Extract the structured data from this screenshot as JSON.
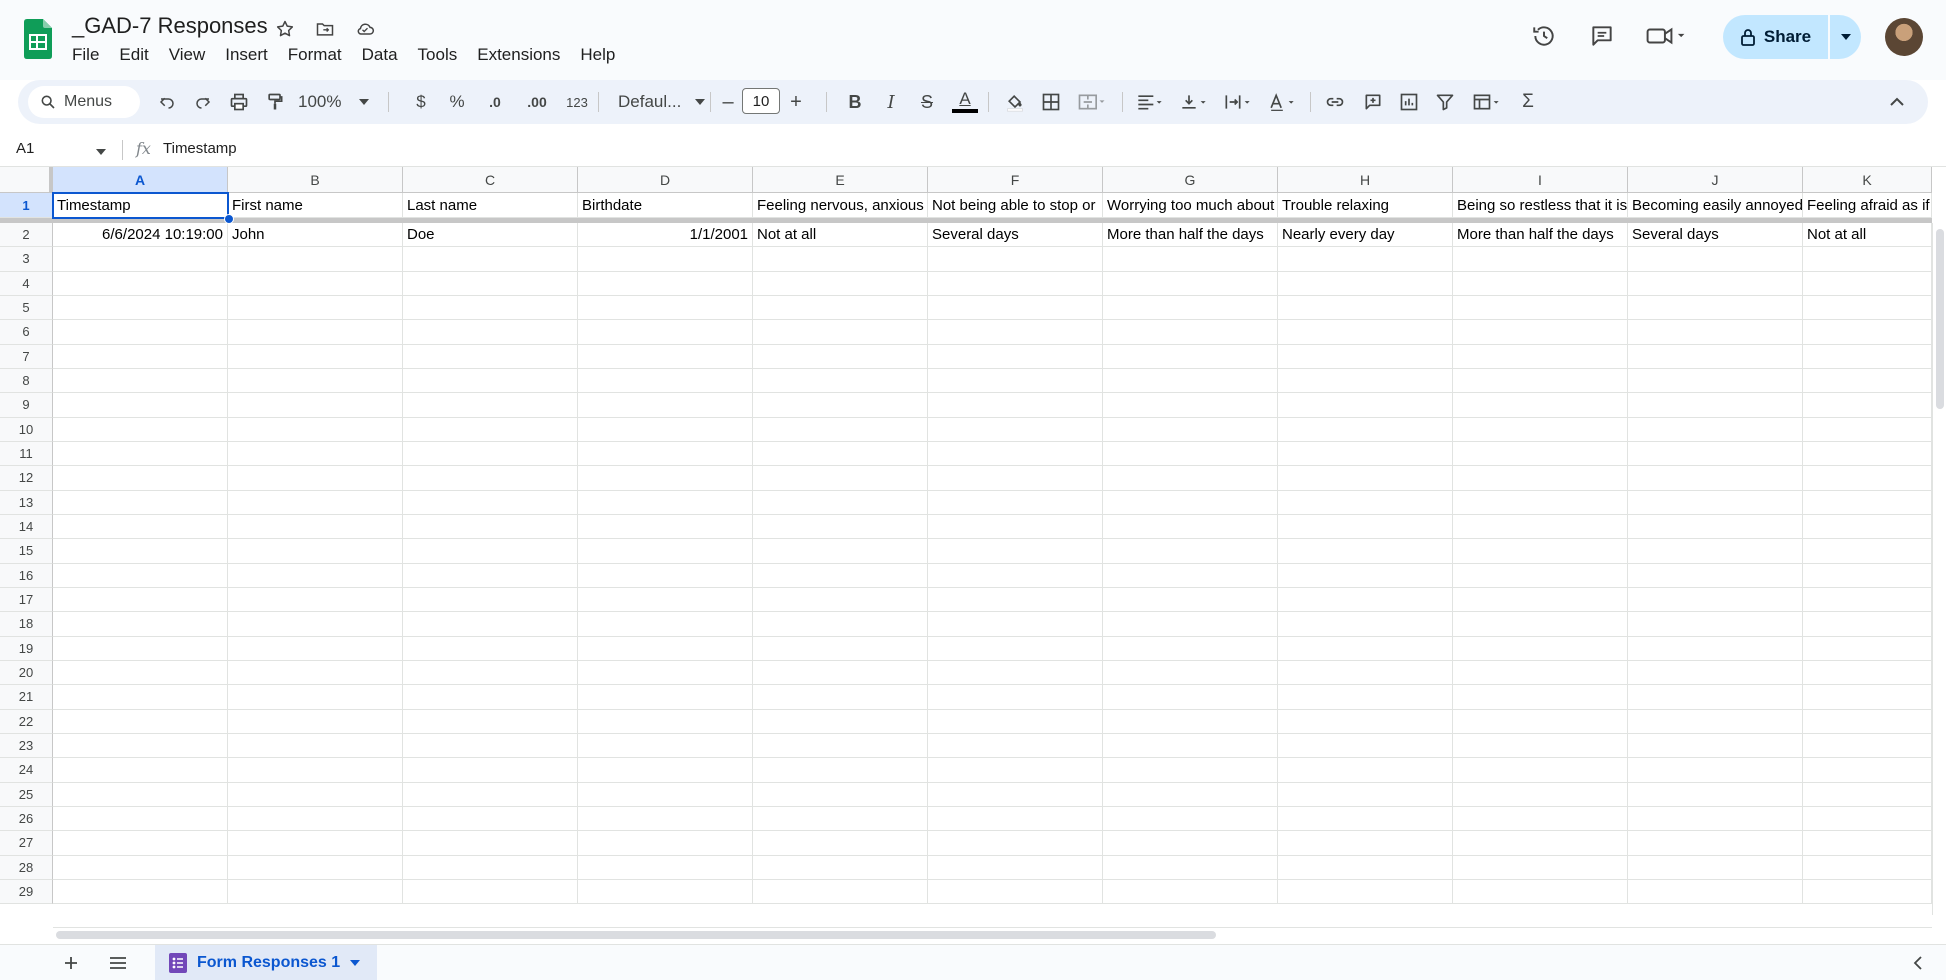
{
  "doc": {
    "title": "_GAD-7 Responses",
    "menu": [
      "File",
      "Edit",
      "View",
      "Insert",
      "Format",
      "Data",
      "Tools",
      "Extensions",
      "Help"
    ]
  },
  "header_actions": {
    "share_label": "Share"
  },
  "toolbar": {
    "search_label": "Menus",
    "zoom": "100%",
    "currency": "$",
    "percent": "%",
    "dec_decrease": ".0",
    "dec_increase": ".00",
    "number_format": "123",
    "font": "Defaul...",
    "font_size": "10",
    "minus": "–",
    "plus": "+",
    "bold": "B",
    "italic": "I",
    "strike": "S",
    "text_color": "A",
    "sum": "Σ"
  },
  "formula": {
    "name_box": "A1",
    "fx": "fx",
    "value": "Timestamp"
  },
  "grid": {
    "columns": [
      "A",
      "B",
      "C",
      "D",
      "E",
      "F",
      "G",
      "H",
      "I",
      "J",
      "K"
    ],
    "rows": [
      [
        "Timestamp",
        "First name",
        "Last name",
        "Birthdate",
        "Feeling nervous, anxious",
        "Not being able to stop or",
        "Worrying too much about",
        "Trouble relaxing",
        "Being so restless that it is",
        "Becoming easily annoyed",
        "Feeling afraid as if"
      ],
      [
        "6/6/2024 10:19:00",
        "John",
        "Doe",
        "1/1/2001",
        "Not at all",
        "Several days",
        "More than half the days",
        "Nearly every day",
        "More than half the days",
        "Several days",
        "Not at all"
      ]
    ],
    "numeric_cells": [
      [
        1,
        0
      ],
      [
        1,
        3
      ]
    ],
    "row_count": 30
  },
  "sheets": {
    "active_tab": "Form Responses 1"
  },
  "colors": {
    "accent": "#0b57d0",
    "share_bg": "#c2e7ff",
    "sheets_green": "#0f9d58",
    "forms_purple": "#7248b9"
  }
}
